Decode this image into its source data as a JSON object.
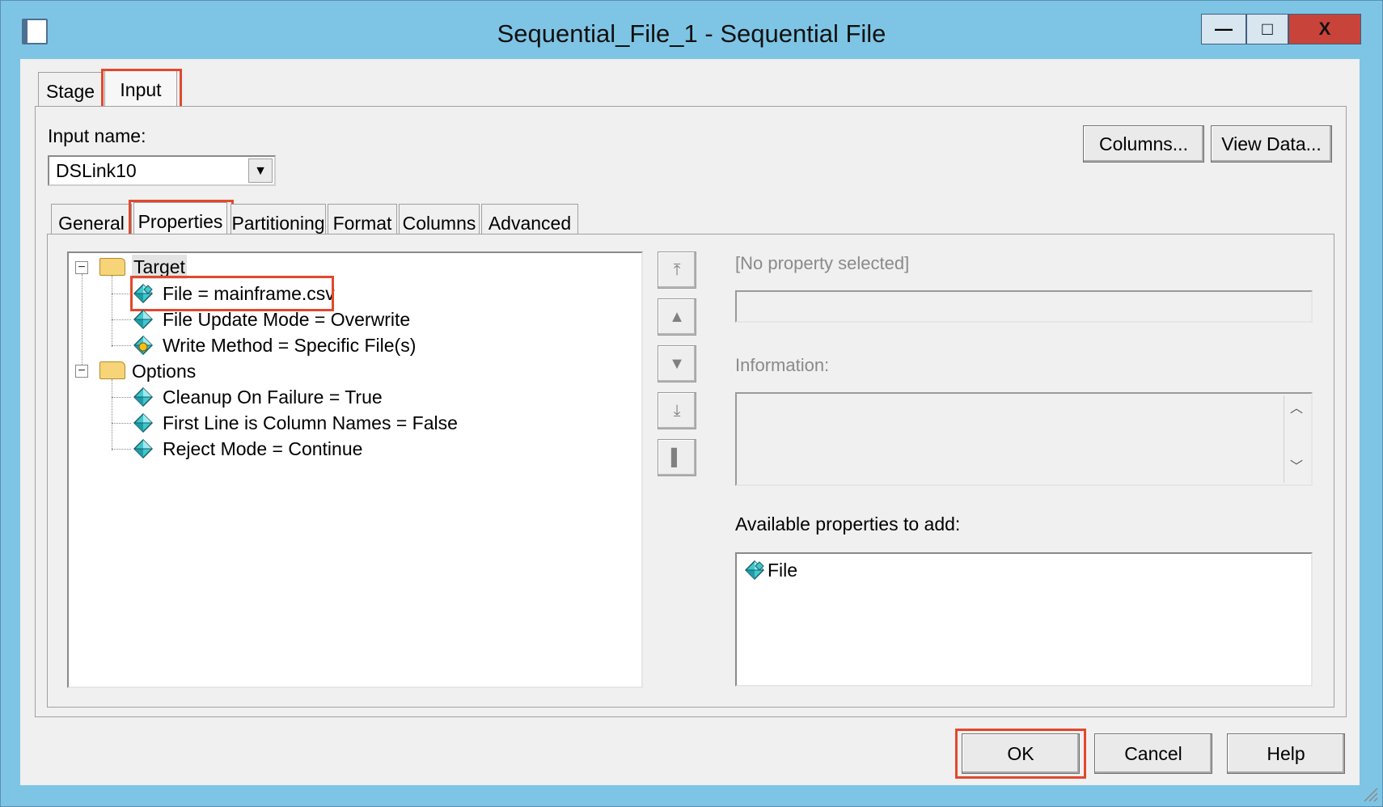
{
  "window": {
    "title": "Sequential_File_1 - Sequential File",
    "buttons": {
      "minimize": "—",
      "maximize": "□",
      "close": "X"
    }
  },
  "top_tabs": [
    {
      "label": "Stage",
      "active": false
    },
    {
      "label": "Input",
      "active": true
    }
  ],
  "input": {
    "label": "Input name:",
    "value": "DSLink10"
  },
  "header_buttons": {
    "columns": "Columns...",
    "view_data": "View Data..."
  },
  "sub_tabs": [
    {
      "label": "General",
      "active": false
    },
    {
      "label": "Properties",
      "active": true
    },
    {
      "label": "Partitioning",
      "active": false
    },
    {
      "label": "Format",
      "active": false
    },
    {
      "label": "Columns",
      "active": false
    },
    {
      "label": "Advanced",
      "active": false
    }
  ],
  "tree": {
    "groups": [
      {
        "name": "Target",
        "expander": "−",
        "items": [
          {
            "label": "File = mainframe.csv",
            "icon": "property-multi-icon"
          },
          {
            "label": "File Update Mode = Overwrite",
            "icon": "property-icon"
          },
          {
            "label": "Write Method = Specific File(s)",
            "icon": "property-required-icon"
          }
        ]
      },
      {
        "name": "Options",
        "expander": "−",
        "items": [
          {
            "label": "Cleanup On Failure = True",
            "icon": "property-icon"
          },
          {
            "label": "First Line is Column Names = False",
            "icon": "property-icon"
          },
          {
            "label": "Reject Mode = Continue",
            "icon": "property-icon"
          }
        ]
      }
    ]
  },
  "side_buttons": {
    "move_top": "⤒",
    "move_up": "▲",
    "move_down": "▼",
    "move_bottom": "⤓",
    "delete": "▌"
  },
  "property_pane": {
    "no_selection": "[No property selected]",
    "information_label": "Information:",
    "available_label": "Available properties to add:",
    "available_items": [
      {
        "label": "File",
        "icon": "property-multi-icon"
      }
    ],
    "scroll_up": "︿",
    "scroll_down": "﹀"
  },
  "footer_buttons": {
    "ok": "OK",
    "cancel": "Cancel",
    "help": "Help"
  },
  "colors": {
    "title_bar": "#7ec5e5",
    "close_button": "#c8433a",
    "highlight": "#e2482e",
    "folder": "#f6d477",
    "property_icon": "#38c6c6"
  }
}
